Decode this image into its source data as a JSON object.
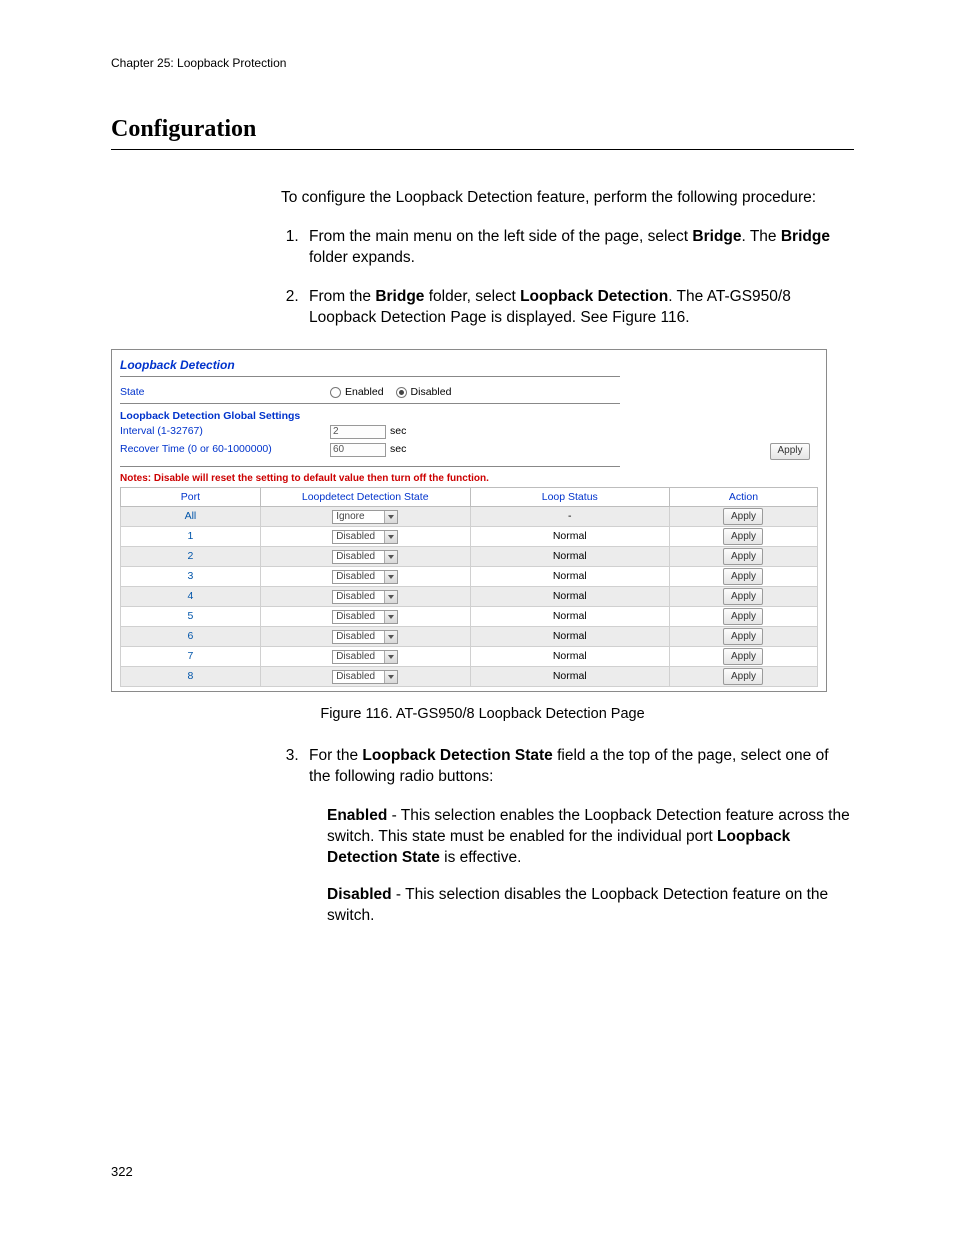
{
  "header": {
    "chapter_line": "Chapter 25: Loopback Protection"
  },
  "section": {
    "title": "Configuration"
  },
  "intro": "To configure the Loopback Detection feature, perform the following procedure:",
  "steps": {
    "s1_a": "From the main menu on the left side of the page, select ",
    "s1_bold": "Bridge",
    "s1_b": ". The ",
    "s1_bold2": "Bridge",
    "s1_c": " folder expands.",
    "s2_a": "From the ",
    "s2_bold": "Bridge",
    "s2_b": " folder, select ",
    "s2_bold2": "Loopback Detection",
    "s2_c": ". The AT-GS950/8 Loopback Detection Page is displayed. See Figure 116.",
    "s3_a": "For the ",
    "s3_bold": "Loopback Detection State",
    "s3_b": " field a the top of the page, select one of the following radio buttons:"
  },
  "figure_caption": "Figure 116. AT-GS950/8 Loopback Detection Page",
  "radio_desc": {
    "enabled_label": "Enabled",
    "enabled_text_a": " - This selection enables the Loopback Detection feature across the switch. This state must be enabled for the individual port ",
    "enabled_bold": "Loopback Detection State",
    "enabled_text_b": " is effective.",
    "disabled_label": "Disabled",
    "disabled_text": " - This selection disables the Loopback Detection feature on the switch."
  },
  "ui": {
    "title": "Loopback Detection",
    "state_label": "State",
    "radio_enabled": "Enabled",
    "radio_disabled": "Disabled",
    "global_heading": "Loopback Detection Global Settings",
    "interval_label": "Interval (1-32767)",
    "interval_value": "2",
    "interval_unit": "sec",
    "recover_label": "Recover Time (0 or 60-1000000)",
    "recover_value": "60",
    "recover_unit": "sec",
    "apply_label": "Apply",
    "notes": "Notes: Disable will reset the setting to default value then turn off the function.",
    "columns": {
      "port": "Port",
      "state": "Loopdetect Detection State",
      "loop": "Loop Status",
      "action": "Action"
    },
    "rows": [
      {
        "port": "All",
        "state": "Ignore",
        "loop": "-",
        "grey": true
      },
      {
        "port": "1",
        "state": "Disabled",
        "loop": "Normal",
        "grey": false
      },
      {
        "port": "2",
        "state": "Disabled",
        "loop": "Normal",
        "grey": true
      },
      {
        "port": "3",
        "state": "Disabled",
        "loop": "Normal",
        "grey": false
      },
      {
        "port": "4",
        "state": "Disabled",
        "loop": "Normal",
        "grey": true
      },
      {
        "port": "5",
        "state": "Disabled",
        "loop": "Normal",
        "grey": false
      },
      {
        "port": "6",
        "state": "Disabled",
        "loop": "Normal",
        "grey": true
      },
      {
        "port": "7",
        "state": "Disabled",
        "loop": "Normal",
        "grey": false
      },
      {
        "port": "8",
        "state": "Disabled",
        "loop": "Normal",
        "grey": true
      }
    ]
  },
  "page_number": "322"
}
